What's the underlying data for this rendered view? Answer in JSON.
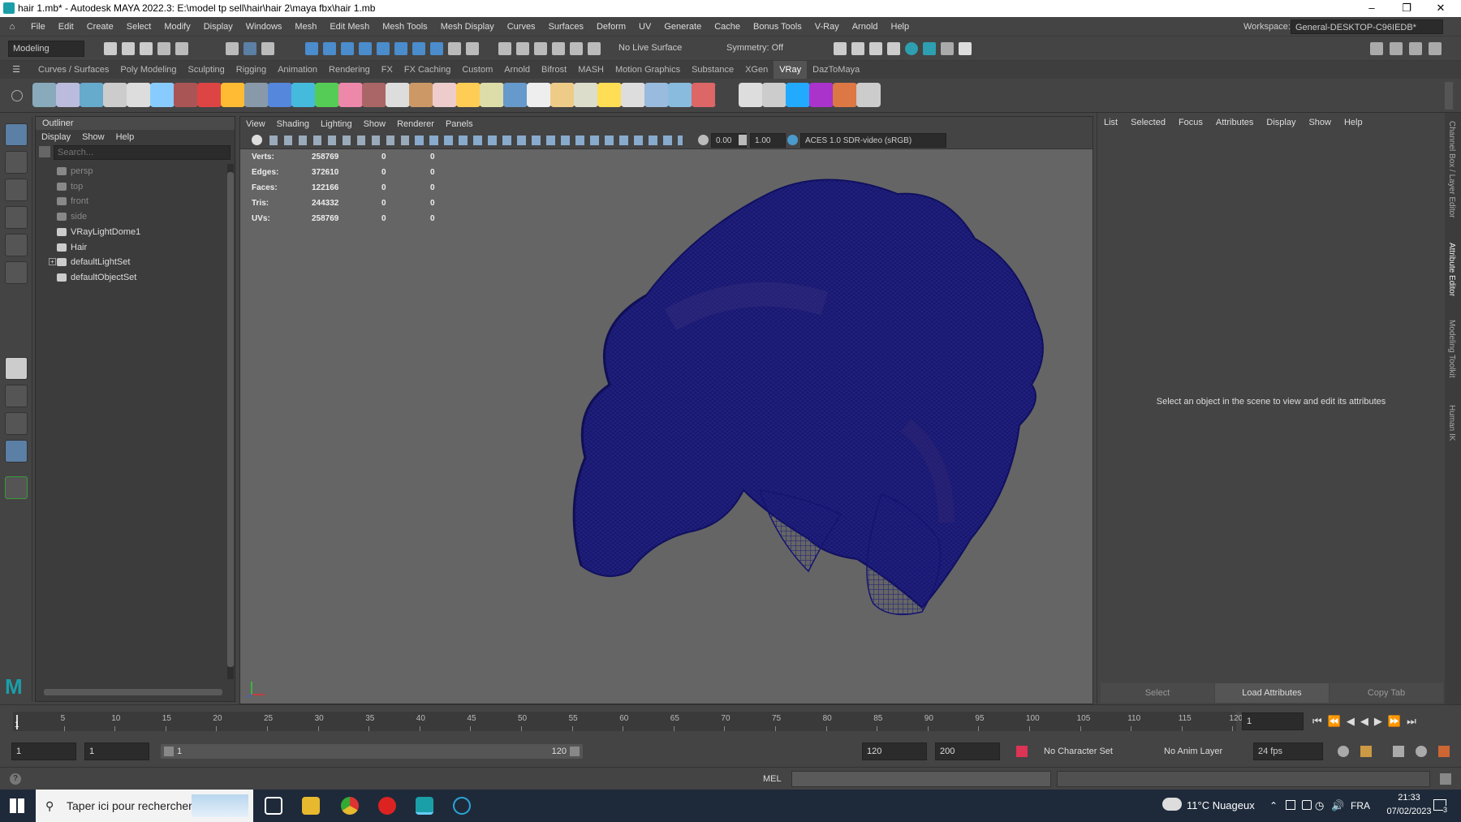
{
  "window": {
    "title": "hair 1.mb* - Autodesk MAYA 2022.3: E:\\model tp sell\\hair\\hair 2\\maya fbx\\hair 1.mb"
  },
  "menubar": {
    "items": [
      "File",
      "Edit",
      "Create",
      "Select",
      "Modify",
      "Display",
      "Windows",
      "Mesh",
      "Edit Mesh",
      "Mesh Tools",
      "Mesh Display",
      "Curves",
      "Surfaces",
      "Deform",
      "UV",
      "Generate",
      "Cache",
      "Bonus Tools",
      "V-Ray",
      "Arnold",
      "Help"
    ],
    "workspace_label": "Workspace:",
    "workspace_value": "General-DESKTOP-C96IEDB*"
  },
  "statusline": {
    "mode": "Modeling",
    "live_surface": "No Live Surface",
    "symmetry": "Symmetry: Off"
  },
  "shelf": {
    "tabs": [
      "Curves / Surfaces",
      "Poly Modeling",
      "Sculpting",
      "Rigging",
      "Animation",
      "Rendering",
      "FX",
      "FX Caching",
      "Custom",
      "Arnold",
      "Bifrost",
      "MASH",
      "Motion Graphics",
      "Substance",
      "XGen",
      "VRay",
      "DazToMaya"
    ],
    "active_tab": "VRay"
  },
  "outliner": {
    "title": "Outliner",
    "menu": [
      "Display",
      "Show",
      "Help"
    ],
    "search_placeholder": "Search...",
    "items": [
      {
        "label": "persp",
        "icon": "camera-icon",
        "dim": true
      },
      {
        "label": "top",
        "icon": "camera-icon",
        "dim": true
      },
      {
        "label": "front",
        "icon": "camera-icon",
        "dim": true
      },
      {
        "label": "side",
        "icon": "camera-icon",
        "dim": true
      },
      {
        "label": "VRayLightDome1",
        "icon": "dome-light-icon",
        "dim": false
      },
      {
        "label": "Hair",
        "icon": "transform-icon",
        "dim": false
      },
      {
        "label": "defaultLightSet",
        "icon": "set-icon",
        "dim": false
      },
      {
        "label": "defaultObjectSet",
        "icon": "set-icon",
        "dim": false
      }
    ]
  },
  "viewport": {
    "menu": [
      "View",
      "Shading",
      "Lighting",
      "Show",
      "Renderer",
      "Panels"
    ],
    "field_a": "0.00",
    "field_b": "1.00",
    "color_space": "ACES 1.0 SDR-video (sRGB)",
    "wire_color": "#16166e",
    "hud": [
      {
        "label": "Verts:",
        "v1": "258769",
        "v2": "0",
        "v3": "0"
      },
      {
        "label": "Edges:",
        "v1": "372610",
        "v2": "0",
        "v3": "0"
      },
      {
        "label": "Faces:",
        "v1": "122166",
        "v2": "0",
        "v3": "0"
      },
      {
        "label": "Tris:",
        "v1": "244332",
        "v2": "0",
        "v3": "0"
      },
      {
        "label": "UVs:",
        "v1": "258769",
        "v2": "0",
        "v3": "0"
      }
    ]
  },
  "attribute_editor": {
    "menu": [
      "List",
      "Selected",
      "Focus",
      "Attributes",
      "Display",
      "Show",
      "Help"
    ],
    "message": "Select an object in the scene to view and edit its attributes",
    "select_btn": "Select",
    "load_btn": "Load Attributes",
    "copy_btn": "Copy Tab",
    "side_tabs": [
      "Channel Box / Layer Editor",
      "Attribute Editor",
      "Modeling Toolkit",
      "Human IK"
    ]
  },
  "timeslider": {
    "ticks": [
      "5",
      "10",
      "15",
      "20",
      "25",
      "30",
      "35",
      "40",
      "45",
      "50",
      "55",
      "60",
      "65",
      "70",
      "75",
      "80",
      "85",
      "90",
      "95",
      "100",
      "105",
      "110",
      "115",
      "120"
    ],
    "current_frame": "1",
    "start_marker": "1"
  },
  "range": {
    "start": "1",
    "playback_start": "1",
    "bar_start": "1",
    "bar_end": "120",
    "playback_end": "120",
    "end": "200",
    "character_set": "No Character Set",
    "anim_layer": "No Anim Layer",
    "fps": "24 fps"
  },
  "cmdline": {
    "lang": "MEL"
  },
  "taskbar": {
    "search": "Taper ici pour rechercher",
    "weather": "11°C  Nuageux",
    "lang": "FRA",
    "time": "21:33",
    "date": "07/02/2023",
    "notif_count": "3"
  }
}
